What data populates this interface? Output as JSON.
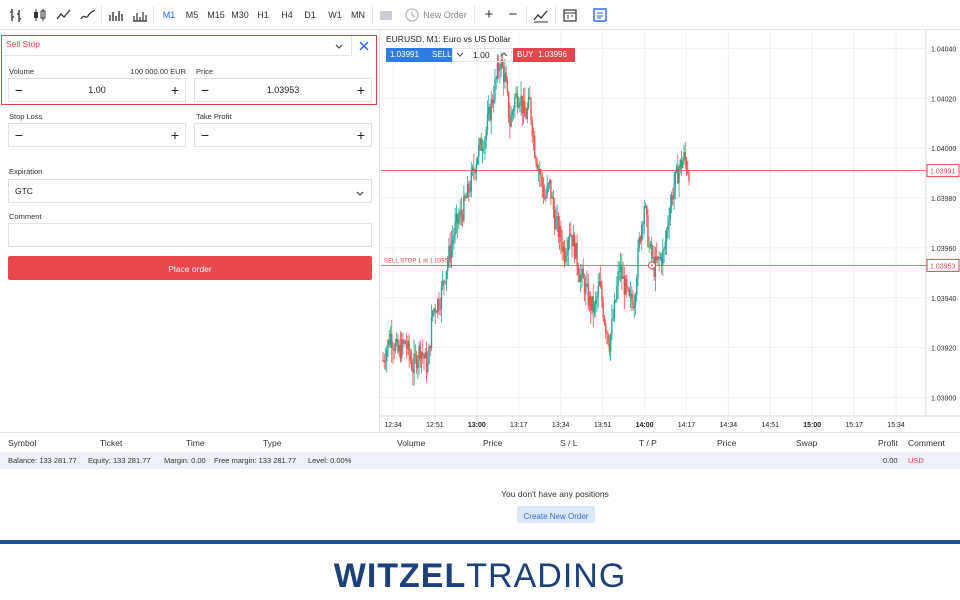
{
  "toolbar": {
    "timeframes": [
      "M1",
      "M5",
      "M15",
      "M30",
      "H1",
      "H4",
      "D1",
      "W1",
      "MN"
    ],
    "active_timeframe": "M1",
    "new_order_label": "New Order"
  },
  "order": {
    "type": "Sell Stop",
    "volume_label": "Volume",
    "volume_amount": "100 000.00 EUR",
    "volume_value": "1.00",
    "price_label": "Price",
    "price_value": "1.03953",
    "stop_loss_label": "Stop Loss",
    "take_profit_label": "Take Profit",
    "expiration_label": "Expiration",
    "expiration_value": "GTC",
    "comment_label": "Comment",
    "place_order_label": "Place order"
  },
  "chart": {
    "title": "EURUSD, M1: Euro vs US Dollar",
    "sell_price": "1.03991",
    "sell_label": "SELL",
    "lot": "1.00",
    "buy_label": "BUY",
    "buy_price": "1.03996",
    "price_ticks": [
      "1.04040",
      "1.04020",
      "1.04000",
      "1.03980",
      "1.03960",
      "1.03940",
      "1.03920",
      "1.03900"
    ],
    "current_price_tag": "1.03991",
    "pending_price_tag": "1.03953",
    "pending_line_label": "SELL STOP 1 at 1.03953",
    "time_ticks": [
      {
        "t": "12:34",
        "b": false
      },
      {
        "t": "12:51",
        "b": false
      },
      {
        "t": "13:00",
        "b": true
      },
      {
        "t": "13:17",
        "b": false
      },
      {
        "t": "13:34",
        "b": false
      },
      {
        "t": "13:51",
        "b": false
      },
      {
        "t": "14:00",
        "b": true
      },
      {
        "t": "14:17",
        "b": false
      },
      {
        "t": "14:34",
        "b": false
      },
      {
        "t": "14:51",
        "b": false
      },
      {
        "t": "15:00",
        "b": true
      },
      {
        "t": "15:17",
        "b": false
      },
      {
        "t": "15:34",
        "b": false
      }
    ],
    "colors": {
      "up": "#26a69a",
      "down": "#ef5350",
      "accent": "#2962ff",
      "sell": "#2f7de1",
      "buy": "#e0474c"
    }
  },
  "chart_data": {
    "type": "candlestick",
    "symbol": "EURUSD",
    "timeframe": "M1",
    "ylim": [
      1.03895,
      1.04045
    ],
    "current_price": 1.03991,
    "pending_order_price": 1.03953,
    "close_path": [
      [
        0,
        1.03915
      ],
      [
        6,
        1.03925
      ],
      [
        12,
        1.03918
      ],
      [
        18,
        1.03922
      ],
      [
        24,
        1.03912
      ],
      [
        30,
        1.0392
      ],
      [
        36,
        1.03912
      ],
      [
        40,
        1.03935
      ],
      [
        46,
        1.0394
      ],
      [
        52,
        1.03955
      ],
      [
        58,
        1.03968
      ],
      [
        64,
        1.03975
      ],
      [
        70,
        1.03985
      ],
      [
        76,
        1.03998
      ],
      [
        82,
        1.04005
      ],
      [
        86,
        1.04015
      ],
      [
        90,
        1.04025
      ],
      [
        94,
        1.04035
      ],
      [
        98,
        1.04028
      ],
      [
        102,
        1.0401
      ],
      [
        106,
        1.0402
      ],
      [
        110,
        1.04022
      ],
      [
        114,
        1.04012
      ],
      [
        118,
        1.04018
      ],
      [
        122,
        1.04
      ],
      [
        126,
        1.0399
      ],
      [
        130,
        1.0398
      ],
      [
        134,
        1.03985
      ],
      [
        138,
        1.03972
      ],
      [
        142,
        1.03965
      ],
      [
        146,
        1.03958
      ],
      [
        150,
        1.03968
      ],
      [
        154,
        1.0396
      ],
      [
        158,
        1.0395
      ],
      [
        162,
        1.03945
      ],
      [
        166,
        1.03938
      ],
      [
        170,
        1.03935
      ],
      [
        174,
        1.03945
      ],
      [
        178,
        1.03932
      ],
      [
        182,
        1.03922
      ],
      [
        186,
        1.03935
      ],
      [
        190,
        1.03952
      ],
      [
        194,
        1.03945
      ],
      [
        198,
        1.03938
      ],
      [
        202,
        1.0394
      ],
      [
        206,
        1.03962
      ],
      [
        210,
        1.03978
      ],
      [
        214,
        1.0396
      ],
      [
        218,
        1.03952
      ],
      [
        222,
        1.03955
      ],
      [
        226,
        1.03958
      ],
      [
        230,
        1.03975
      ],
      [
        234,
        1.03985
      ],
      [
        238,
        1.03992
      ],
      [
        242,
        1.03996
      ],
      [
        246,
        1.03991
      ]
    ]
  },
  "positions": {
    "headers": [
      "Symbol",
      "Ticket",
      "Time",
      "Type",
      "Volume",
      "Price",
      "S / L",
      "T / P",
      "Price",
      "Swap",
      "Profit",
      "Comment"
    ],
    "balance": "Balance: 133 281.77",
    "equity": "Equity: 133 281.77",
    "margin": "Margin: 0.00",
    "free_margin": "Free margin: 133 281.77",
    "level": "Level: 0.00%",
    "profit": "0.00",
    "currency": "USD",
    "empty_text": "You don't have any positions",
    "create_button": "Create New Order"
  },
  "brand": {
    "part1": "WITZEL",
    "part2": "TRADING"
  }
}
